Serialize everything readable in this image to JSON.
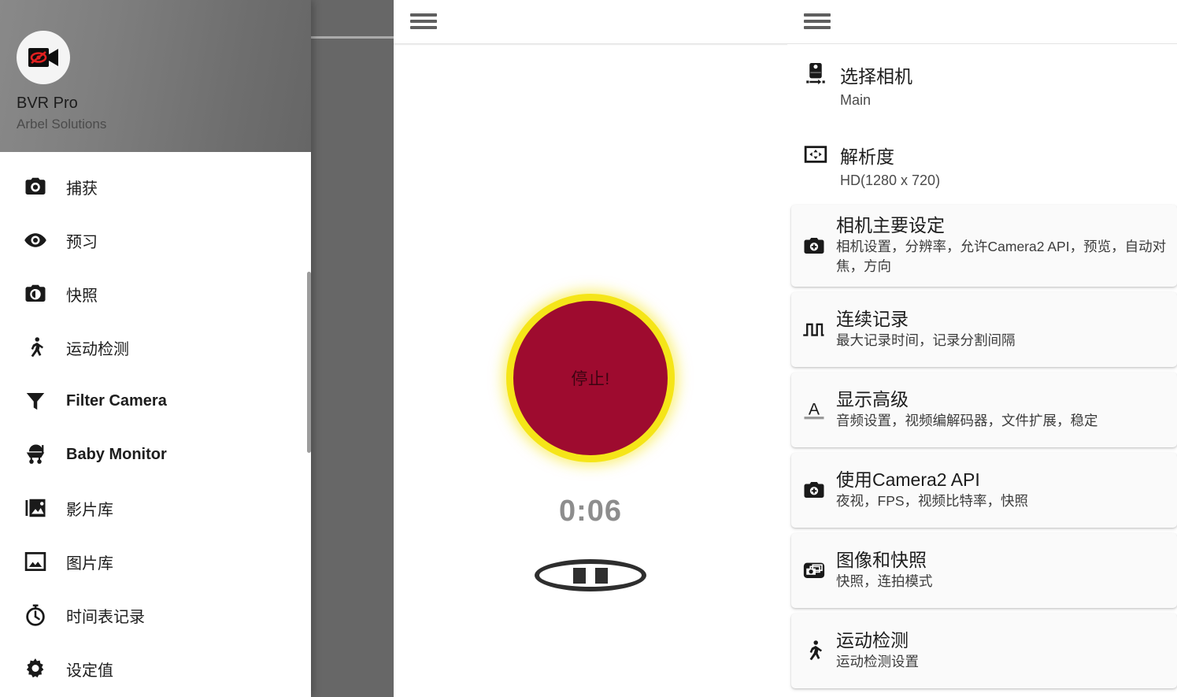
{
  "app": {
    "name": "BVR Pro",
    "developer": "Arbel Solutions",
    "logo_icon": "video-camera-hidden-icon"
  },
  "drawer": {
    "menu_icon": "hamburger-menu-icon",
    "items": [
      {
        "label": "捕获",
        "icon": "camera-filled-icon",
        "latin": false
      },
      {
        "label": "预习",
        "icon": "eye-icon",
        "latin": false
      },
      {
        "label": "快照",
        "icon": "camera-snapshot-icon",
        "latin": false
      },
      {
        "label": "运动检测",
        "icon": "running-person-icon",
        "latin": false
      },
      {
        "label": "Filter Camera",
        "icon": "funnel-filter-icon",
        "latin": true
      },
      {
        "label": "Baby Monitor",
        "icon": "baby-stroller-icon",
        "latin": true
      },
      {
        "label": "影片库",
        "icon": "video-library-icon",
        "latin": false
      },
      {
        "label": "图片库",
        "icon": "photo-library-icon",
        "latin": false
      },
      {
        "label": "时间表记录",
        "icon": "stopwatch-icon",
        "latin": false
      },
      {
        "label": "设定值",
        "icon": "gear-settings-icon",
        "latin": false
      }
    ]
  },
  "recorder": {
    "menu_icon": "hamburger-menu-icon",
    "record_button_label": "停止!",
    "record_button_color": "#9e0b2f",
    "record_button_ring_color": "#f5e518",
    "timer": "0:06",
    "pause_icon": "pause-button-icon"
  },
  "settings": {
    "menu_icon": "hamburger-menu-icon",
    "plain_rows": [
      {
        "title": "选择相机",
        "value": "Main",
        "icon": "camera-switch-icon"
      },
      {
        "title": "解析度",
        "value": "HD(1280 x 720)",
        "icon": "resolution-icon"
      }
    ],
    "cards": [
      {
        "title": "相机主要设定",
        "subtitle": "相机设置，分辨率，允许Camera2 API，预览，自动对焦，方向",
        "icon": "camera-settings-icon"
      },
      {
        "title": "连续记录",
        "subtitle": "最大记录时间，记录分割间隔",
        "icon": "square-wave-icon"
      },
      {
        "title": "显示高级",
        "subtitle": "音频设置，视频编解码器，文件扩展，稳定",
        "icon": "text-format-a-icon"
      },
      {
        "title": "使用Camera2 API",
        "subtitle": "夜视，FPS，视频比特率，快照",
        "icon": "camera-settings-icon"
      },
      {
        "title": "图像和快照",
        "subtitle": "快照，连拍模式",
        "icon": "photo-stack-icon"
      },
      {
        "title": "运动检测",
        "subtitle": "运动检测设置",
        "icon": "running-person-icon"
      }
    ]
  }
}
